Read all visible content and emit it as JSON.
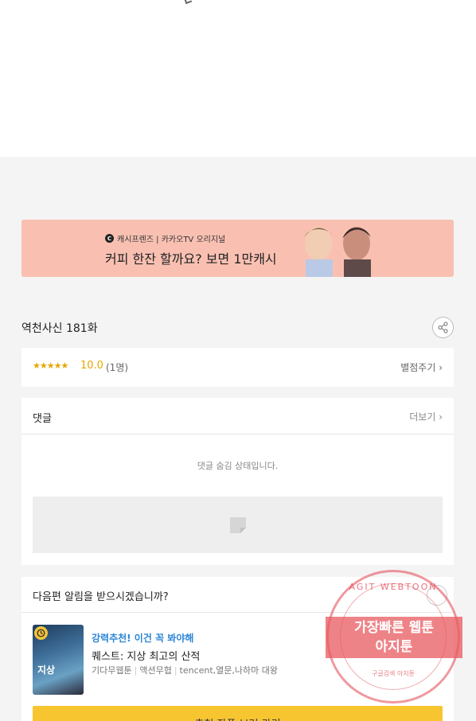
{
  "ad": {
    "sub_text": "캐시프렌즈 | 카카오TV 오리지널",
    "main_text": "커피 한잔 할까요? 보면 1만캐시"
  },
  "episode": {
    "title": "역천사신 181화"
  },
  "rating": {
    "stars": "★★★★★",
    "score": "10.0",
    "votes": "(1명)",
    "rate_link": "별점주기 ›"
  },
  "comments": {
    "title": "댓글",
    "more": "더보기 ›",
    "hidden_message": "댓글 숨김 상태입니다."
  },
  "notify": {
    "question": "다음편 알림을 받으시겠습니까?"
  },
  "recommend": {
    "tag": "강력추천! 이건 꼭 봐야해",
    "title": "퀘스트: 지상 최고의 산적",
    "meta": [
      "기다무웹툰",
      "액션무협",
      "tencent,열문,나하마 대왕"
    ],
    "button": "추천 작품 보러 가기",
    "thumb_text": "지상"
  },
  "stamp": {
    "top": "AGIT WEBTOON",
    "line1": "가장빠른 웹툰",
    "line2": "아지툰",
    "bottom": "구글검색 아지툰"
  },
  "colors": {
    "accent_yellow": "#f7c530",
    "star": "#e6a700",
    "tag_blue": "#2a86d6",
    "ad_bg": "#f9c0b2"
  }
}
